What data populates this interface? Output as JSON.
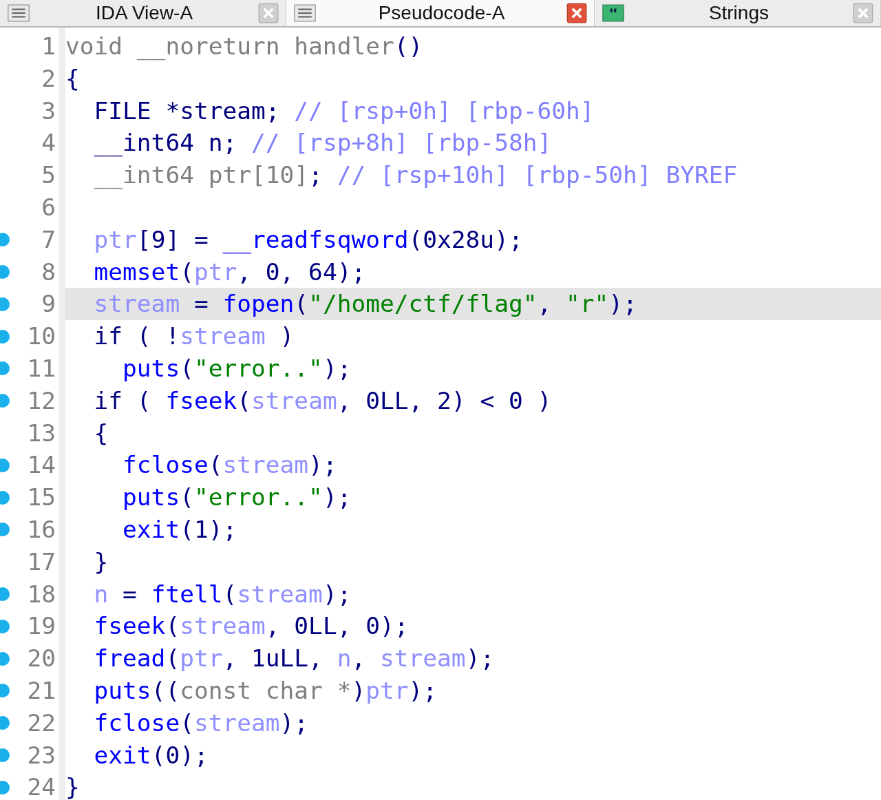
{
  "tabs": [
    {
      "label": "IDA View-A",
      "selected": false,
      "kind": "listing"
    },
    {
      "label": "Pseudocode-A",
      "selected": true,
      "kind": "listing"
    },
    {
      "label": "Strings",
      "selected": false,
      "kind": "strings"
    }
  ],
  "lines": [
    {
      "number": "1",
      "breakpoint": false,
      "highlighted": false,
      "tokens": [
        {
          "text": "void __noreturn handler",
          "kind": "type"
        },
        {
          "text": "()",
          "kind": "plain"
        }
      ]
    },
    {
      "number": "2",
      "breakpoint": false,
      "highlighted": false,
      "tokens": [
        {
          "text": "{",
          "kind": "plain"
        }
      ]
    },
    {
      "number": "3",
      "breakpoint": false,
      "highlighted": false,
      "tokens": [
        {
          "text": "  FILE *stream; ",
          "kind": "plain"
        },
        {
          "text": "// [rsp+0h] [rbp-60h]",
          "kind": "comment"
        }
      ]
    },
    {
      "number": "4",
      "breakpoint": false,
      "highlighted": false,
      "tokens": [
        {
          "text": "  __int64 n; ",
          "kind": "plain"
        },
        {
          "text": "// [rsp+8h] [rbp-58h]",
          "kind": "comment"
        }
      ]
    },
    {
      "number": "5",
      "breakpoint": false,
      "highlighted": false,
      "tokens": [
        {
          "text": "  __int64 ptr[10]",
          "kind": "type"
        },
        {
          "text": "; ",
          "kind": "plain"
        },
        {
          "text": "// [rsp+10h] [rbp-50h] BYREF",
          "kind": "comment"
        }
      ]
    },
    {
      "number": "6",
      "breakpoint": false,
      "highlighted": false
    },
    {
      "number": "7",
      "breakpoint": true,
      "highlighted": false,
      "tokens": [
        {
          "text": "  ptr",
          "kind": "var"
        },
        {
          "text": "[9] = ",
          "kind": "plain"
        },
        {
          "text": "__readfsqword",
          "kind": "func"
        },
        {
          "text": "(0x28u);",
          "kind": "plain"
        }
      ]
    },
    {
      "number": "8",
      "breakpoint": true,
      "highlighted": false,
      "tokens": [
        {
          "text": "  memset",
          "kind": "func"
        },
        {
          "text": "(",
          "kind": "plain"
        },
        {
          "text": "ptr",
          "kind": "var"
        },
        {
          "text": ", 0, 64);",
          "kind": "plain"
        }
      ]
    },
    {
      "number": "9",
      "breakpoint": true,
      "highlighted": true,
      "tokens": [
        {
          "text": "  stream",
          "kind": "var"
        },
        {
          "text": " = ",
          "kind": "plain"
        },
        {
          "text": "fopen",
          "kind": "func"
        },
        {
          "text": "(",
          "kind": "plain"
        },
        {
          "text": "\"/home/ctf/flag\"",
          "kind": "string"
        },
        {
          "text": ", ",
          "kind": "plain"
        },
        {
          "text": "\"r\"",
          "kind": "string"
        },
        {
          "text": ");",
          "kind": "plain"
        }
      ]
    },
    {
      "number": "10",
      "breakpoint": true,
      "highlighted": false,
      "tokens": [
        {
          "text": "  if ( !",
          "kind": "plain"
        },
        {
          "text": "stream",
          "kind": "var"
        },
        {
          "text": " )",
          "kind": "plain"
        }
      ]
    },
    {
      "number": "11",
      "breakpoint": true,
      "highlighted": false,
      "tokens": [
        {
          "text": "    puts",
          "kind": "func"
        },
        {
          "text": "(",
          "kind": "plain"
        },
        {
          "text": "\"error..\"",
          "kind": "string"
        },
        {
          "text": ");",
          "kind": "plain"
        }
      ]
    },
    {
      "number": "12",
      "breakpoint": true,
      "highlighted": false,
      "tokens": [
        {
          "text": "  if ( ",
          "kind": "plain"
        },
        {
          "text": "fseek",
          "kind": "func"
        },
        {
          "text": "(",
          "kind": "plain"
        },
        {
          "text": "stream",
          "kind": "var"
        },
        {
          "text": ", 0LL, 2) < 0 )",
          "kind": "plain"
        }
      ]
    },
    {
      "number": "13",
      "breakpoint": false,
      "highlighted": false,
      "tokens": [
        {
          "text": "  {",
          "kind": "plain"
        }
      ]
    },
    {
      "number": "14",
      "breakpoint": true,
      "highlighted": false,
      "tokens": [
        {
          "text": "    fclose",
          "kind": "func"
        },
        {
          "text": "(",
          "kind": "plain"
        },
        {
          "text": "stream",
          "kind": "var"
        },
        {
          "text": ");",
          "kind": "plain"
        }
      ]
    },
    {
      "number": "15",
      "breakpoint": true,
      "highlighted": false,
      "tokens": [
        {
          "text": "    puts",
          "kind": "func"
        },
        {
          "text": "(",
          "kind": "plain"
        },
        {
          "text": "\"error..\"",
          "kind": "string"
        },
        {
          "text": ");",
          "kind": "plain"
        }
      ]
    },
    {
      "number": "16",
      "breakpoint": true,
      "highlighted": false,
      "tokens": [
        {
          "text": "    exit",
          "kind": "func"
        },
        {
          "text": "(1);",
          "kind": "plain"
        }
      ]
    },
    {
      "number": "17",
      "breakpoint": false,
      "highlighted": false,
      "tokens": [
        {
          "text": "  }",
          "kind": "plain"
        }
      ]
    },
    {
      "number": "18",
      "breakpoint": true,
      "highlighted": false,
      "tokens": [
        {
          "text": "  n",
          "kind": "var"
        },
        {
          "text": " = ",
          "kind": "plain"
        },
        {
          "text": "ftell",
          "kind": "func"
        },
        {
          "text": "(",
          "kind": "plain"
        },
        {
          "text": "stream",
          "kind": "var"
        },
        {
          "text": ");",
          "kind": "plain"
        }
      ]
    },
    {
      "number": "19",
      "breakpoint": true,
      "highlighted": false,
      "tokens": [
        {
          "text": "  fseek",
          "kind": "func"
        },
        {
          "text": "(",
          "kind": "plain"
        },
        {
          "text": "stream",
          "kind": "var"
        },
        {
          "text": ", 0LL, 0);",
          "kind": "plain"
        }
      ]
    },
    {
      "number": "20",
      "breakpoint": true,
      "highlighted": false,
      "tokens": [
        {
          "text": "  fread",
          "kind": "func"
        },
        {
          "text": "(",
          "kind": "plain"
        },
        {
          "text": "ptr",
          "kind": "var"
        },
        {
          "text": ", 1uLL, ",
          "kind": "plain"
        },
        {
          "text": "n",
          "kind": "var"
        },
        {
          "text": ", ",
          "kind": "plain"
        },
        {
          "text": "stream",
          "kind": "var"
        },
        {
          "text": ");",
          "kind": "plain"
        }
      ]
    },
    {
      "number": "21",
      "breakpoint": true,
      "highlighted": false,
      "tokens": [
        {
          "text": "  puts",
          "kind": "func"
        },
        {
          "text": "((",
          "kind": "plain"
        },
        {
          "text": "const char *",
          "kind": "type"
        },
        {
          "text": ")",
          "kind": "plain"
        },
        {
          "text": "ptr",
          "kind": "var"
        },
        {
          "text": ");",
          "kind": "plain"
        }
      ]
    },
    {
      "number": "22",
      "breakpoint": true,
      "highlighted": false,
      "tokens": [
        {
          "text": "  fclose",
          "kind": "func"
        },
        {
          "text": "(",
          "kind": "plain"
        },
        {
          "text": "stream",
          "kind": "var"
        },
        {
          "text": ");",
          "kind": "plain"
        }
      ]
    },
    {
      "number": "23",
      "breakpoint": true,
      "highlighted": false,
      "tokens": [
        {
          "text": "  exit",
          "kind": "func"
        },
        {
          "text": "(0);",
          "kind": "plain"
        }
      ]
    },
    {
      "number": "24",
      "breakpoint": true,
      "highlighted": false,
      "tokens": [
        {
          "text": "}",
          "kind": "plain"
        }
      ]
    }
  ]
}
